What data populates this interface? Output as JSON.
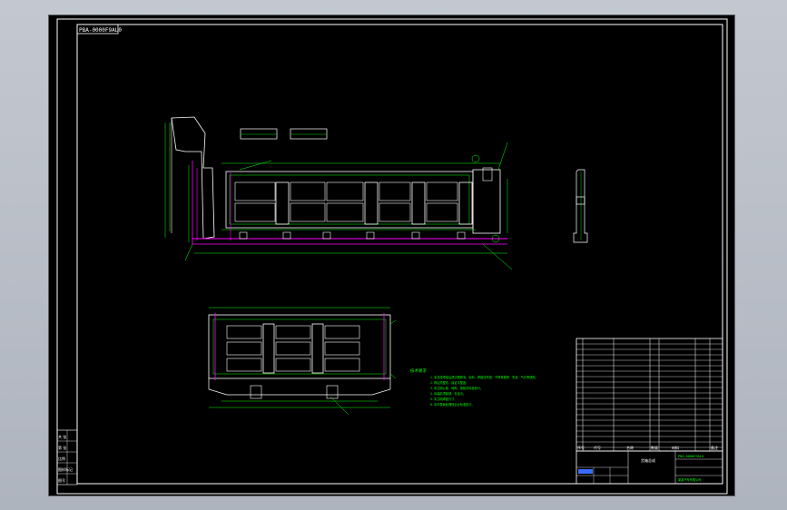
{
  "drawing": {
    "drawing_number": "PBA-0000F9AL0",
    "notes_title": "技术要求",
    "notes": [
      "1. 本总成焊接后须清理焊渣、毛刺，焊缝应牢固，不得有漏焊、夹渣、气孔等缺陷。",
      "2. 焊后须整形，保证平整度。",
      "3. 未注明公差、间隙，按相关标准执行。",
      "4. 涂装前须除锈、去油污。",
      "5. 未注明焊缝尺寸。",
      "6. 本件表面处理按企业标准执行。"
    ],
    "title_block": {
      "part_name": "货箱总成",
      "part_number": "PBA-0000F9AL0",
      "company": "某某汽车有限公司",
      "col_headers": [
        "序号",
        "代号",
        "名称",
        "数量",
        "材料",
        "备注"
      ]
    },
    "sheet_info": [
      "共 张",
      "第 张",
      "比例",
      "图样标记",
      "图号"
    ]
  },
  "colors": {
    "background": "#000000",
    "lines": "#ffffff",
    "parts": "#00ff00",
    "hidden": "#ff00ff",
    "dims": "#ff3030",
    "blue": "#3a6cff"
  }
}
